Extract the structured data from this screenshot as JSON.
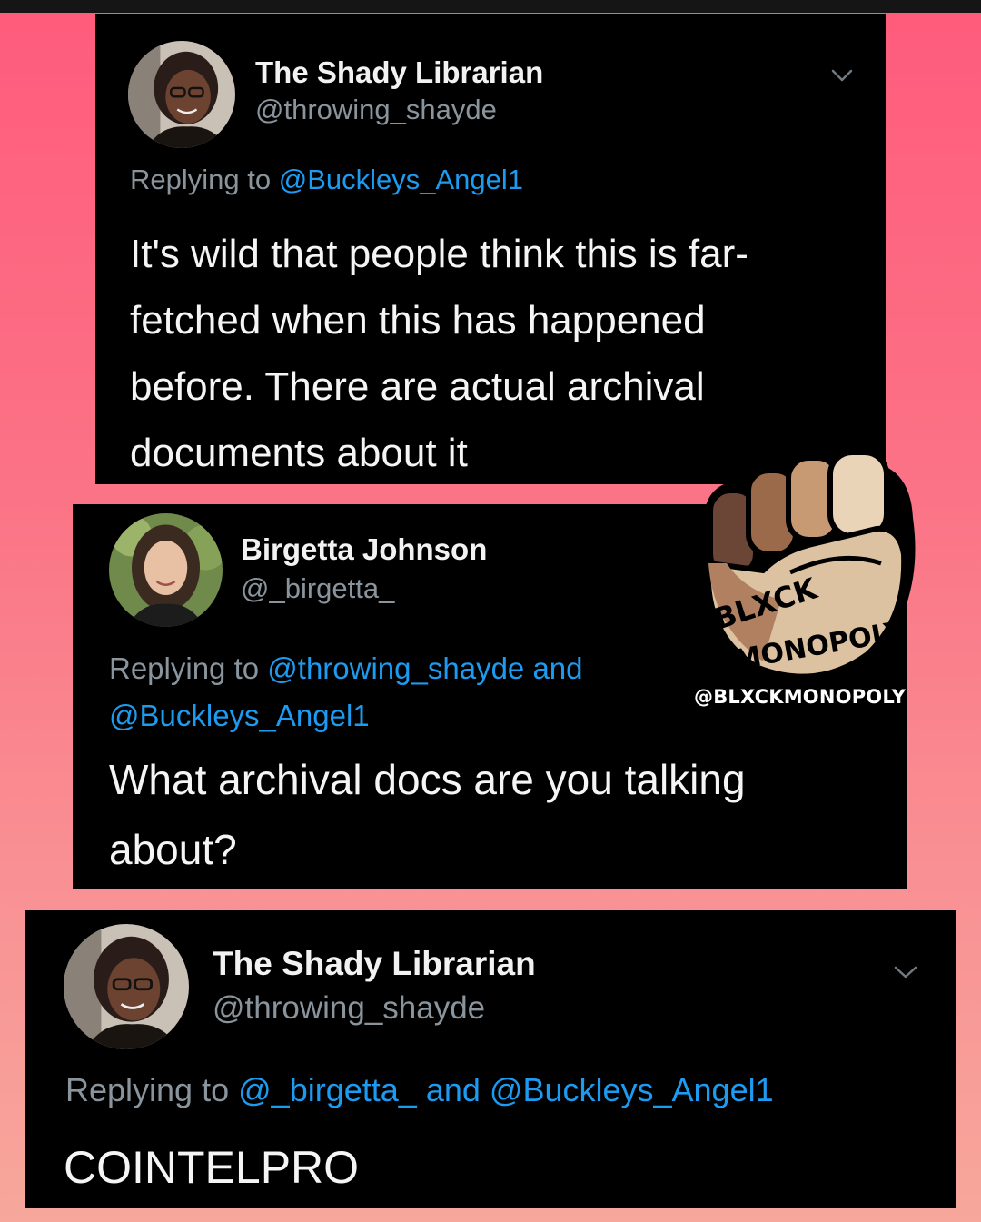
{
  "tweets": [
    {
      "name": "The Shady Librarian",
      "handle": "@throwing_shayde",
      "reply_prefix": "Replying to",
      "mention_1": "@Buckleys_Angel1",
      "body": "It's wild that people think this is far-fetched when this has happened before. There are actual archival documents about it"
    },
    {
      "name": "Birgetta Johnson",
      "handle": "@_birgetta_",
      "reply_prefix": "Replying to",
      "mention_1": "@throwing_shayde",
      "conjunction": "and",
      "mention_2": "@Buckleys_Angel1",
      "body": "What archival docs are you talking about?"
    },
    {
      "name": "The Shady Librarian",
      "handle": "@throwing_shayde",
      "reply_prefix": "Replying to",
      "mention_1": "@_birgetta_",
      "conjunction": "and",
      "mention_2": "@Buckleys_Angel1",
      "body": "COINTELPRO"
    }
  ],
  "watermark": {
    "logo_text": "BLXCK MONOPOLY",
    "handle": "@BLXCKMONOPOLY"
  },
  "icons": {
    "caret": "chevron-down-icon",
    "avatar": "avatar",
    "logo": "raised-fist-logo"
  },
  "colors": {
    "card_background": "#000000",
    "mention": "#1d9bf0",
    "muted": "#8a949c",
    "gradient_top": "#ff5b7c",
    "gradient_bottom": "#f7a79c"
  }
}
